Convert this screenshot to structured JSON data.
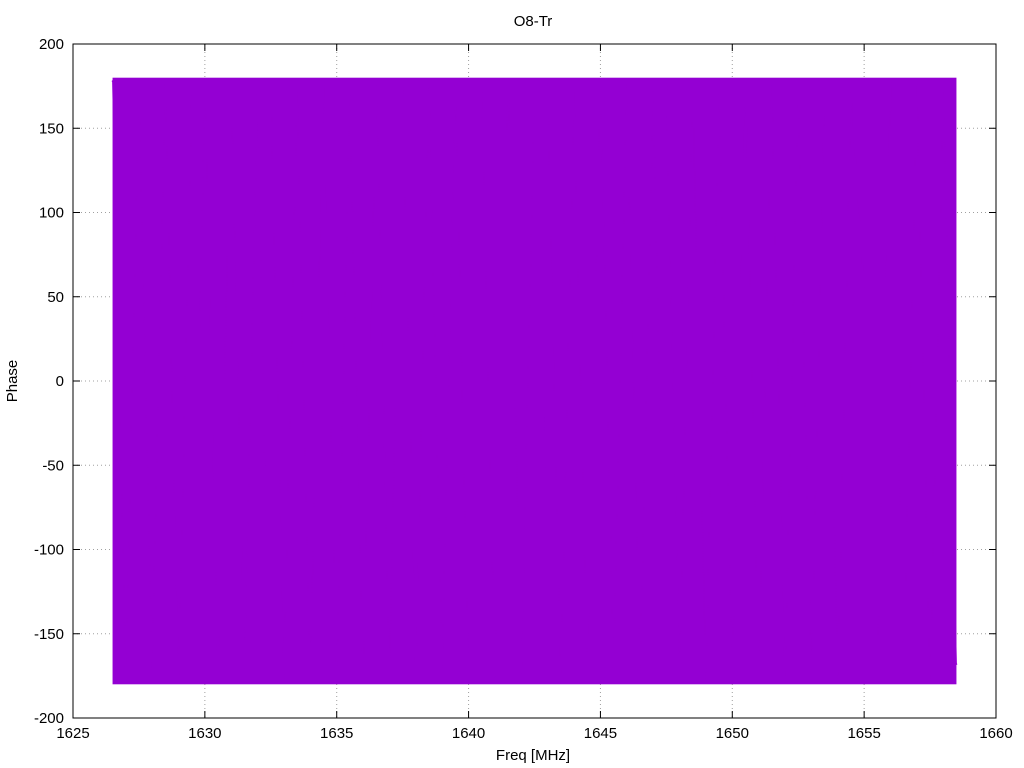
{
  "chart_data": {
    "type": "line",
    "title": "O8-Tr",
    "xlabel": "Freq [MHz]",
    "ylabel": "Phase",
    "xlim": [
      1625,
      1660
    ],
    "ylim": [
      -200,
      200
    ],
    "xticks": [
      1625,
      1630,
      1635,
      1640,
      1645,
      1650,
      1655,
      1660
    ],
    "yticks": [
      -200,
      -150,
      -100,
      -50,
      0,
      50,
      100,
      150,
      200
    ],
    "grid": true,
    "legend": "none",
    "series": [
      {
        "color": "#9400d3",
        "x_range": [
          1626.5,
          1658.5
        ],
        "y_min": -180,
        "y_max": 180,
        "x": [
          1626.5,
          1627.0,
          1627.5,
          1628.0,
          1628.5,
          1629.0,
          1629.5,
          1629.8,
          1630.0,
          1630.5,
          1631.0,
          1631.5,
          1632.0,
          1632.3,
          1632.5,
          1633.0,
          1633.5,
          1634.0,
          1634.5,
          1635.0,
          1635.5,
          1636.0,
          1636.5,
          1637.0,
          1637.5,
          1638.0,
          1638.5,
          1639.0,
          1639.5,
          1640.0,
          1640.2,
          1640.5,
          1641.0,
          1641.5,
          1642.0,
          1642.5,
          1642.9,
          1643.0,
          1643.5,
          1644.0,
          1644.5,
          1645.0,
          1645.5,
          1646.0,
          1646.5,
          1647.0,
          1647.3,
          1647.5,
          1648.0,
          1648.5,
          1649.0,
          1649.5,
          1650.0,
          1650.5,
          1651.0,
          1651.5,
          1652.0,
          1652.5,
          1653.0,
          1653.5,
          1654.0,
          1654.5,
          1655.0,
          1655.5,
          1656.0,
          1656.5,
          1657.0,
          1657.5,
          1658.0,
          1658.5
        ],
        "y": [
          178,
          -176,
          172,
          -170,
          176,
          -178,
          170,
          30,
          176,
          -175,
          178,
          -172,
          170,
          -77,
          176,
          -178,
          172,
          -174,
          178,
          -176,
          170,
          -178,
          176,
          -172,
          178,
          -176,
          174,
          -170,
          176,
          -178,
          31,
          172,
          -176,
          178,
          -174,
          170,
          -52,
          176,
          -178,
          172,
          -176,
          178,
          -170,
          176,
          -174,
          172,
          -49,
          178,
          -176,
          174,
          -178,
          170,
          -176,
          178,
          -172,
          176,
          -178,
          170,
          -176,
          174,
          -178,
          172,
          55,
          -176,
          178,
          -174,
          176,
          -178,
          172,
          -168
        ]
      }
    ]
  }
}
